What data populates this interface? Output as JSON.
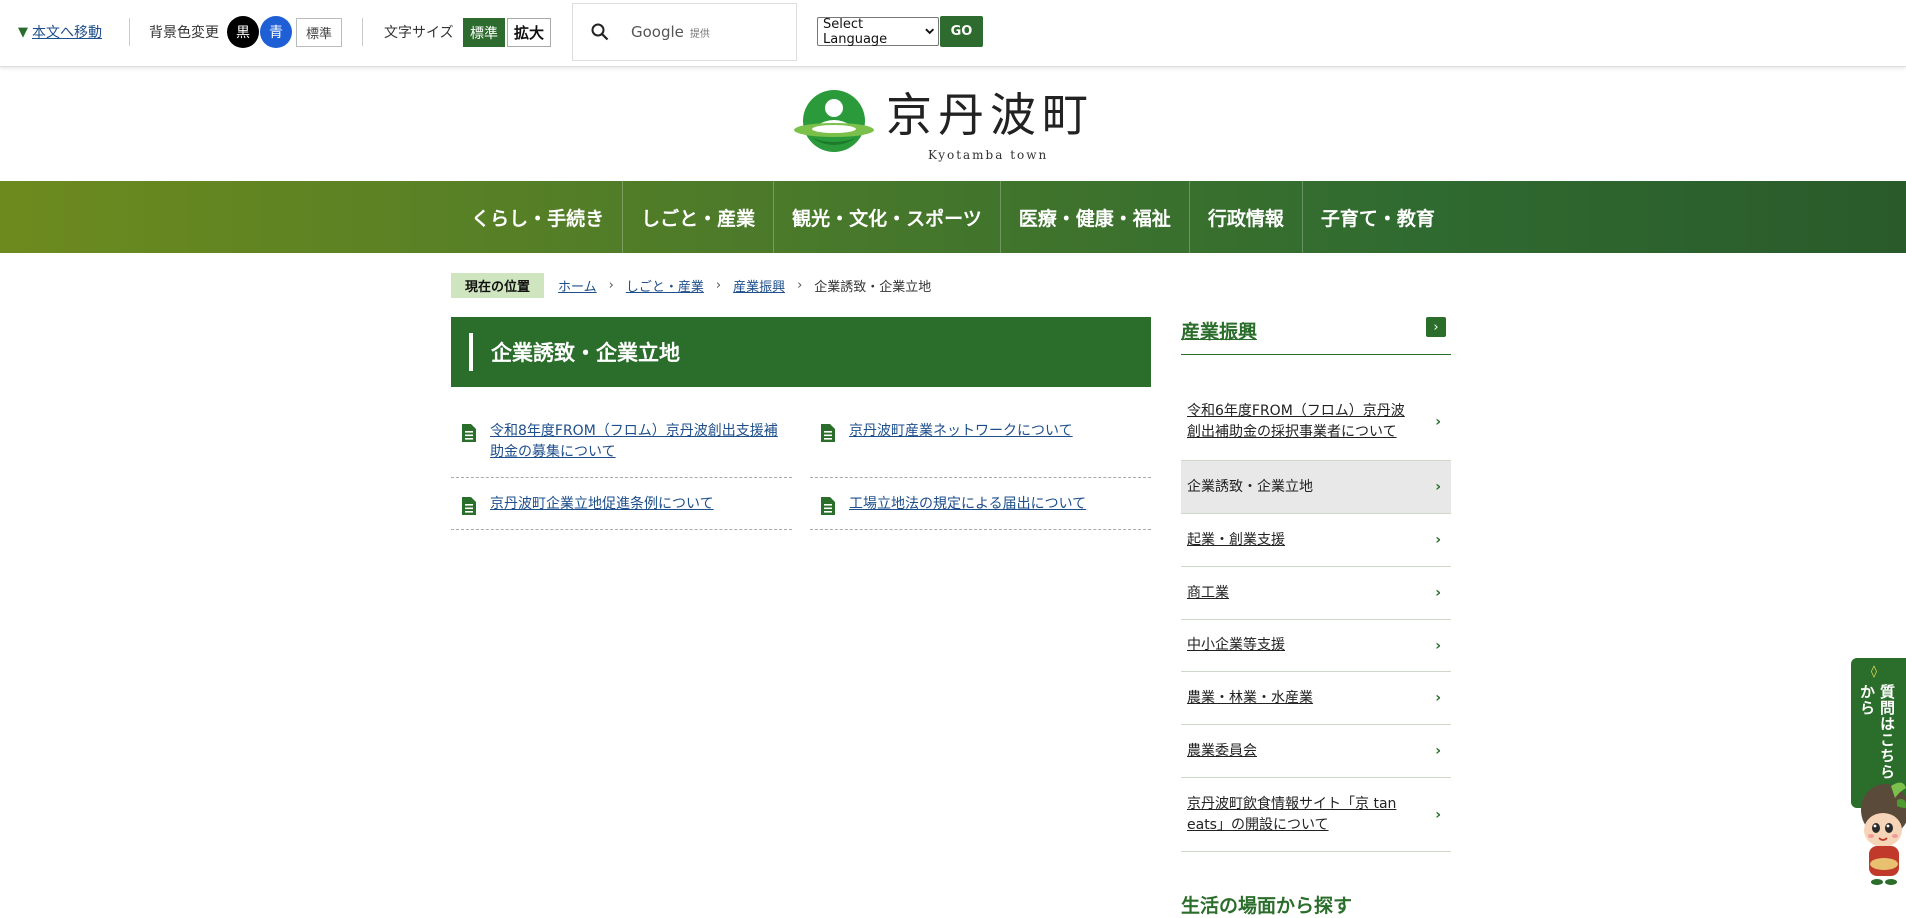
{
  "utility": {
    "skip_link": "本文へ移動",
    "bg_label": "背景色変更",
    "bg_black": "黒",
    "bg_blue": "青",
    "bg_standard": "標準",
    "font_label": "文字サイズ",
    "font_standard": "標準",
    "font_large": "拡大",
    "search_brand": "Google",
    "search_provided": "提供",
    "language_select": "Select Language",
    "go_button": "GO"
  },
  "logo": {
    "title": "京丹波町",
    "subtitle": "Kyotamba town"
  },
  "nav": {
    "items": [
      "くらし・手続き",
      "しごと・産業",
      "観光・文化・スポーツ",
      "医療・健康・福祉",
      "行政情報",
      "子育て・教育"
    ]
  },
  "breadcrumb": {
    "label": "現在の位置",
    "items": [
      "ホーム",
      "しごと・産業",
      "産業振興"
    ],
    "current": "企業誘致・企業立地"
  },
  "page": {
    "title": "企業誘致・企業立地",
    "links": [
      "令和8年度FROM（フロム）京丹波創出支援補助金の募集について",
      "京丹波町産業ネットワークについて",
      "京丹波町企業立地促進条例について",
      "工場立地法の規定による届出について"
    ]
  },
  "sidebar": {
    "title": "産業振興",
    "items": [
      "令和6年度FROM（フロム）京丹波創出補助金の採択事業者について",
      "企業誘致・企業立地",
      "起業・創業支援",
      "商工業",
      "中小企業等支援",
      "農業・林業・水産業",
      "農業委員会",
      "京丹波町飲食情報サイト「京 tan eats」の開設について"
    ],
    "active_index": 1,
    "next_heading": "生活の場面から探す"
  },
  "chat": {
    "label": "質問はこちらから"
  },
  "colors": {
    "primary_green": "#2b6d2b",
    "link_blue": "#1e4f8c"
  }
}
